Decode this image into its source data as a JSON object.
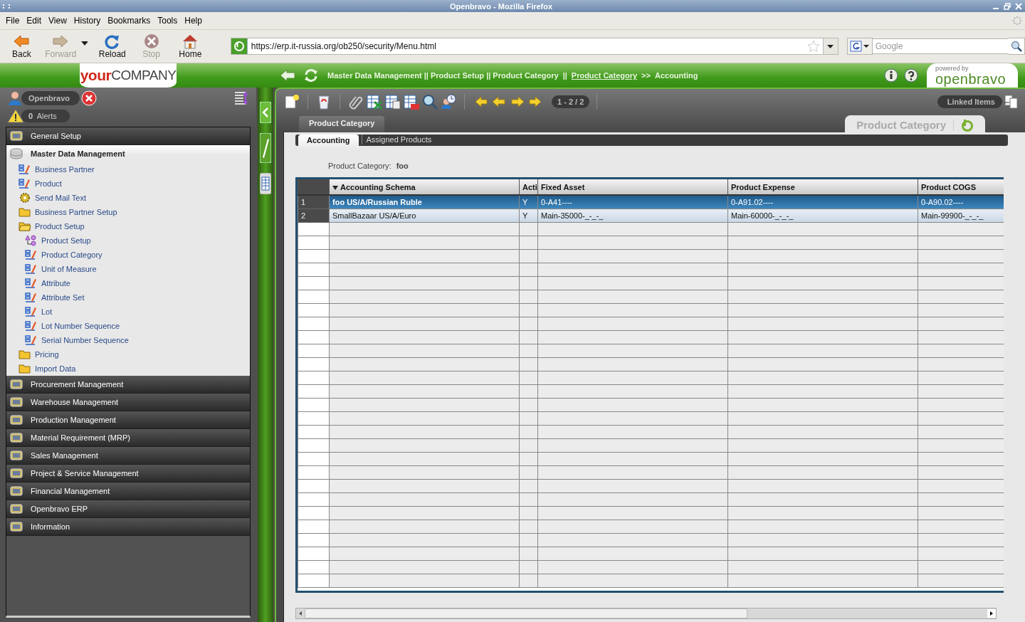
{
  "window": {
    "title": "Openbravo - Mozilla Firefox"
  },
  "menu_bar": [
    "File",
    "Edit",
    "View",
    "History",
    "Bookmarks",
    "Tools",
    "Help"
  ],
  "nav_buttons": [
    {
      "kind": "back",
      "label": "Back",
      "disabled": false
    },
    {
      "kind": "forward",
      "label": "Forward",
      "disabled": true
    },
    {
      "kind": "reload",
      "label": "Reload",
      "disabled": false
    },
    {
      "kind": "stop",
      "label": "Stop",
      "disabled": true
    },
    {
      "kind": "home",
      "label": "Home",
      "disabled": false
    }
  ],
  "address_bar": {
    "value": "https://erp.it-russia.org/ob250/security/Menu.html"
  },
  "search": {
    "placeholder": "Google"
  },
  "app_header": {
    "logo": "**your**COMPANY",
    "breadcrumb": [
      {
        "kind": "text",
        "text": "Master Data Management || Product Setup || Product Category"
      },
      {
        "kind": "sep",
        "text": "||"
      },
      {
        "kind": "link",
        "text": "Product Category"
      },
      {
        "kind": "sep",
        "text": ">>"
      },
      {
        "kind": "text",
        "text": "Accounting"
      }
    ],
    "powered_by": "powered by",
    "brand": "openbravo"
  },
  "user": {
    "name": "Openbravo"
  },
  "alerts": {
    "count": "0",
    "label": "Alerts"
  },
  "sidebar": {
    "items": [
      {
        "kind": "module",
        "label": "General Setup",
        "expanded": false
      },
      {
        "kind": "module",
        "label": "Master Data Management",
        "expanded": true,
        "children": [
          {
            "kind": "window",
            "label": "Business Partner"
          },
          {
            "kind": "window",
            "label": "Product"
          },
          {
            "kind": "process",
            "label": "Send Mail Text"
          },
          {
            "kind": "folder",
            "label": "Business Partner Setup",
            "expanded": false
          },
          {
            "kind": "folder",
            "label": "Product Setup",
            "expanded": true,
            "children": [
              {
                "kind": "setup",
                "label": "Product Setup"
              },
              {
                "kind": "window",
                "label": "Product Category"
              },
              {
                "kind": "window",
                "label": "Unit of Measure"
              },
              {
                "kind": "window",
                "label": "Attribute"
              },
              {
                "kind": "window",
                "label": "Attribute Set"
              },
              {
                "kind": "window",
                "label": "Lot"
              },
              {
                "kind": "window",
                "label": "Lot Number Sequence"
              },
              {
                "kind": "window",
                "label": "Serial Number Sequence"
              }
            ]
          },
          {
            "kind": "folder",
            "label": "Pricing",
            "expanded": false
          },
          {
            "kind": "folder",
            "label": "Import Data",
            "expanded": false
          }
        ]
      },
      {
        "kind": "module",
        "label": "Procurement Management",
        "expanded": false
      },
      {
        "kind": "module",
        "label": "Warehouse Management",
        "expanded": false
      },
      {
        "kind": "module",
        "label": "Production Management",
        "expanded": false
      },
      {
        "kind": "module",
        "label": "Material Requirement (MRP)",
        "expanded": false
      },
      {
        "kind": "module",
        "label": "Sales Management",
        "expanded": false
      },
      {
        "kind": "module",
        "label": "Project & Service Management",
        "expanded": false
      },
      {
        "kind": "module",
        "label": "Financial Management",
        "expanded": false
      },
      {
        "kind": "module",
        "label": "Openbravo ERP",
        "expanded": false
      },
      {
        "kind": "module",
        "label": "Information",
        "expanded": false
      }
    ]
  },
  "toolbar": {
    "record_count": "1 - 2 / 2",
    "linked_items": "Linked Items"
  },
  "parent_tab": "Product Category",
  "window_title": "Product Category",
  "tabs": [
    {
      "label": "Accounting",
      "selected": true
    },
    {
      "label": "Assigned Products",
      "selected": false
    }
  ],
  "header_field": {
    "label": "Product Category:",
    "value": "foo"
  },
  "table": {
    "columns": [
      {
        "label": "Accounting Schema",
        "sorted": true
      },
      {
        "label": "Acti",
        "sorted": false
      },
      {
        "label": "Fixed Asset",
        "sorted": false
      },
      {
        "label": "Product Expense",
        "sorted": false
      },
      {
        "label": "Product COGS",
        "sorted": false
      }
    ],
    "rows": [
      {
        "number": "1",
        "selected": true,
        "cells": [
          "foo US/A/Russian Ruble",
          "Y",
          "0-A41----",
          "0-A91.02----",
          "0-A90.02----"
        ]
      },
      {
        "number": "2",
        "selected": false,
        "cells": [
          "SmallBazaar US/A/Euro",
          "Y",
          "Main-35000-_-_-_",
          "Main-60000-_-_-_",
          "Main-99900-_-_-_"
        ]
      }
    ]
  }
}
